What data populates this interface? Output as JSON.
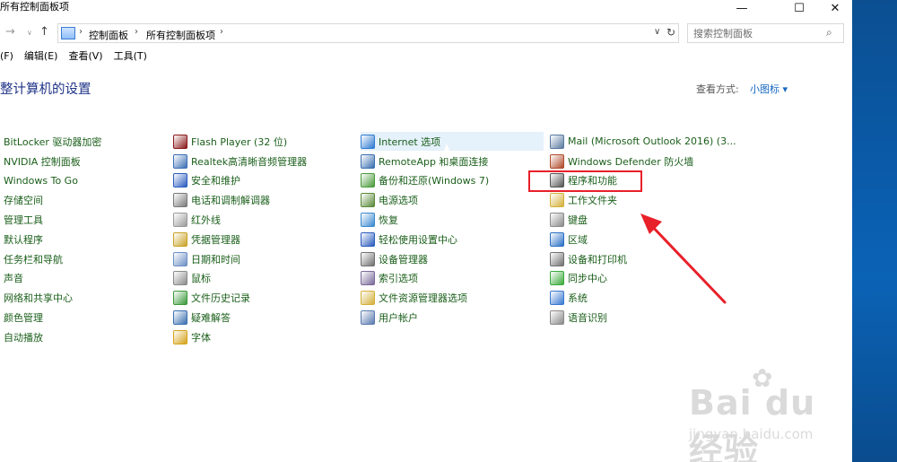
{
  "window": {
    "title": "所有控制面板项",
    "buttons": {
      "minimize": "—",
      "maximize": "☐",
      "close": "✕"
    }
  },
  "addressbar": {
    "back": "→",
    "dropdown": "∨",
    "up": "↑",
    "crumbs": [
      "控制面板",
      "所有控制面板项"
    ],
    "sep": "›",
    "addr_dropdown": "∨",
    "refresh": "↻",
    "search_placeholder": "搜索控制面板",
    "search_icon": "⌕"
  },
  "menubar": [
    "(F)",
    "编辑(E)",
    "查看(V)",
    "工具(T)"
  ],
  "heading": "整计算机的设置",
  "viewby": {
    "label": "查看方式:",
    "value": "小图标 ▾"
  },
  "columns": [
    [
      {
        "label": "BitLocker 驱动器加密"
      },
      {
        "label": "NVIDIA 控制面板"
      },
      {
        "label": "Windows To Go"
      },
      {
        "label": "存储空间"
      },
      {
        "label": "管理工具"
      },
      {
        "label": "默认程序"
      },
      {
        "label": "任务栏和导航"
      },
      {
        "label": "声音"
      },
      {
        "label": "网络和共享中心"
      },
      {
        "label": "颜色管理"
      },
      {
        "label": "自动播放"
      }
    ],
    [
      {
        "label": "Flash Player (32 位)",
        "icon": "flash-icon",
        "color": "#8b1a1a"
      },
      {
        "label": "Realtek高清晰音频管理器",
        "icon": "speaker-icon",
        "color": "#3b6fb5"
      },
      {
        "label": "安全和维护",
        "icon": "flag-icon",
        "color": "#2a5bbf"
      },
      {
        "label": "电话和调制解调器",
        "icon": "phone-icon",
        "color": "#7a7a7a"
      },
      {
        "label": "红外线",
        "icon": "infrared-icon",
        "color": "#9a9a9a"
      },
      {
        "label": "凭据管理器",
        "icon": "credential-icon",
        "color": "#c9a227"
      },
      {
        "label": "日期和时间",
        "icon": "clock-icon",
        "color": "#6d8fc5"
      },
      {
        "label": "鼠标",
        "icon": "mouse-icon",
        "color": "#8a8a8a"
      },
      {
        "label": "文件历史记录",
        "icon": "history-icon",
        "color": "#3a9a3a"
      },
      {
        "label": "疑难解答",
        "icon": "troubleshoot-icon",
        "color": "#3a6fb0"
      },
      {
        "label": "字体",
        "icon": "font-icon",
        "color": "#d4a21a"
      }
    ],
    [
      {
        "label": "Internet 选项",
        "icon": "internet-icon",
        "color": "#2f7ad1"
      },
      {
        "label": "RemoteApp 和桌面连接",
        "icon": "remoteapp-icon",
        "color": "#3a6fb0"
      },
      {
        "label": "备份和还原(Windows 7)",
        "icon": "backup-icon",
        "color": "#4a9a3a"
      },
      {
        "label": "电源选项",
        "icon": "power-icon",
        "color": "#5a8a3a"
      },
      {
        "label": "恢复",
        "icon": "recovery-icon",
        "color": "#3a8ad0"
      },
      {
        "label": "轻松使用设置中心",
        "icon": "ease-icon",
        "color": "#2a5bbf"
      },
      {
        "label": "设备管理器",
        "icon": "device-manager-icon",
        "color": "#707070"
      },
      {
        "label": "索引选项",
        "icon": "index-icon",
        "color": "#7a6a9a"
      },
      {
        "label": "文件资源管理器选项",
        "icon": "folder-options-icon",
        "color": "#d4b03a"
      },
      {
        "label": "用户帐户",
        "icon": "user-accounts-icon",
        "color": "#5a7ab0"
      }
    ],
    [
      {
        "label": "Mail (Microsoft Outlook 2016) (3...",
        "icon": "mail-icon",
        "color": "#5a7aa0"
      },
      {
        "label": "Windows Defender 防火墙",
        "icon": "firewall-icon",
        "color": "#b04a2a"
      },
      {
        "label": "程序和功能",
        "icon": "programs-icon",
        "color": "#555555"
      },
      {
        "label": "工作文件夹",
        "icon": "work-folders-icon",
        "color": "#d4b03a"
      },
      {
        "label": "键盘",
        "icon": "keyboard-icon",
        "color": "#8a8a8a"
      },
      {
        "label": "区域",
        "icon": "region-icon",
        "color": "#2a6fc5"
      },
      {
        "label": "设备和打印机",
        "icon": "printer-icon",
        "color": "#707070"
      },
      {
        "label": "同步中心",
        "icon": "sync-icon",
        "color": "#3aaa3a"
      },
      {
        "label": "系统",
        "icon": "system-icon",
        "color": "#3a7ad1"
      },
      {
        "label": "语音识别",
        "icon": "microphone-icon",
        "color": "#8a8a8a"
      }
    ]
  ],
  "watermark": {
    "brand": "Bai du 经验",
    "sub": "jingyan.baidu.com",
    "paw": "✿"
  },
  "colors": {
    "link_green": "#1a5e1a",
    "heading_blue": "#1e3287",
    "highlight_red": "#e8202a"
  }
}
